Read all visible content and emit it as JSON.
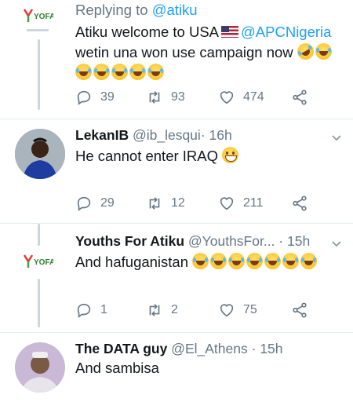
{
  "tweets": [
    {
      "reply_to_prefix": "Replying to",
      "reply_to_handle": "@atiku",
      "text_line1_pre": "Atiku welcome to USA",
      "text_line1_mention": "@APCNigeria",
      "text_line2": "wetin una won use campaign now",
      "replies": "39",
      "retweets": "93",
      "likes": "474",
      "avatar_text": "YOFA"
    },
    {
      "name": "LekanIB",
      "handle": "@ib_lesqui",
      "dot": "·",
      "time": "16h",
      "text": "He cannot enter IRAQ",
      "replies": "29",
      "retweets": "12",
      "likes": "211"
    },
    {
      "name": "Youths For Atiku",
      "handle": "@YouthsFor...",
      "dot": "·",
      "time": "15h",
      "text": "And hafuganistan",
      "replies": "1",
      "retweets": "2",
      "likes": "75",
      "avatar_text": "YOFA"
    },
    {
      "name": "The DATA guy",
      "handle": "@El_Athens",
      "dot": "·",
      "time": "15h",
      "text": "And sambisa"
    }
  ],
  "colors": {
    "accent": "#1da1f2",
    "muted": "#657786",
    "thread": "#ccd6dd"
  }
}
